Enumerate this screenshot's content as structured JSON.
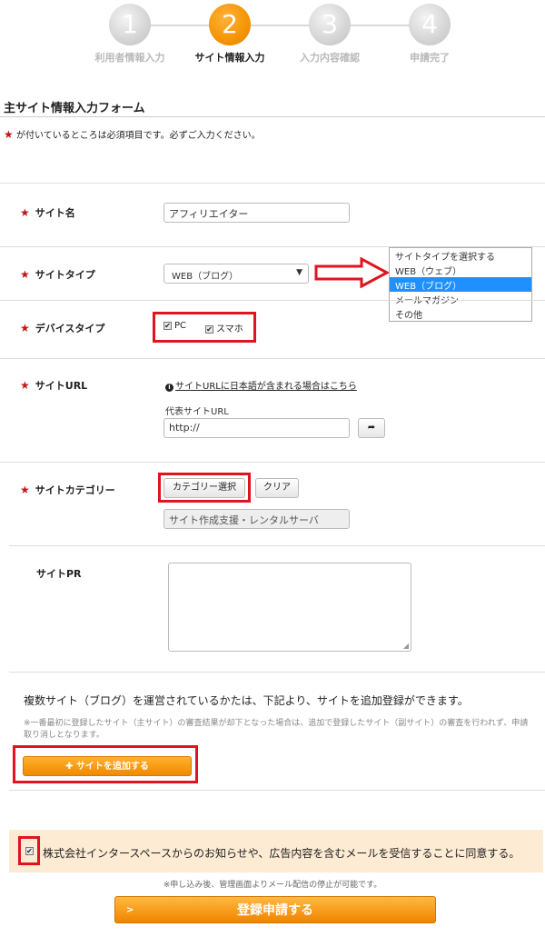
{
  "steps": [
    {
      "number": "1",
      "label": "利用者情報入力"
    },
    {
      "number": "2",
      "label": "サイト情報入力"
    },
    {
      "number": "3",
      "label": "入力内容確認"
    },
    {
      "number": "4",
      "label": "申請完了"
    }
  ],
  "form": {
    "title": "主サイト情報入力フォーム",
    "required_notice": "が付いているところは必須項目です。必ずご入力ください。",
    "site_name": {
      "label": "サイト名",
      "value": "アフィリエイター"
    },
    "site_type": {
      "label": "サイトタイプ",
      "selected": "WEB（ブログ）",
      "options": [
        "サイトタイプを選択する",
        "WEB（ウェブ）",
        "WEB（ブログ）",
        "メールマガジン",
        "その他"
      ]
    },
    "device_type": {
      "label": "デバイスタイプ",
      "pc_label": "PC",
      "sp_label": "スマホ"
    },
    "site_url": {
      "label": "サイトURL",
      "help_link": "サイトURLに日本語が含まれる場合はこちら",
      "sub_label": "代表サイトURL",
      "value": "http://"
    },
    "category": {
      "label": "サイトカテゴリー",
      "select_button": "カテゴリー選択",
      "clear_button": "クリア",
      "selected_value": "サイト作成支援・レンタルサーバ"
    },
    "site_pr": {
      "label": "サイトPR"
    }
  },
  "multi_site": {
    "text": "複数サイト（ブログ）を運営されているかたは、下記より、サイトを追加登録ができます。",
    "note": "※一番最初に登録したサイト（主サイト）の審査結果が却下となった場合は、追加で登録したサイト（副サイト）の審査を行われず、申請取り消しとなります。",
    "add_button": "サイトを追加する"
  },
  "agreement": {
    "text": "株式会社インタースペースからのお知らせや、広告内容を含むメールを受信することに同意する。",
    "stop_note": "※申し込み後、管理画面よりメール配信の停止が可能です。"
  },
  "submit_label": "登録申請する",
  "colors": {
    "accent": "#f39200",
    "required_star": "#c0161b",
    "highlight_box": "#e0141e"
  }
}
